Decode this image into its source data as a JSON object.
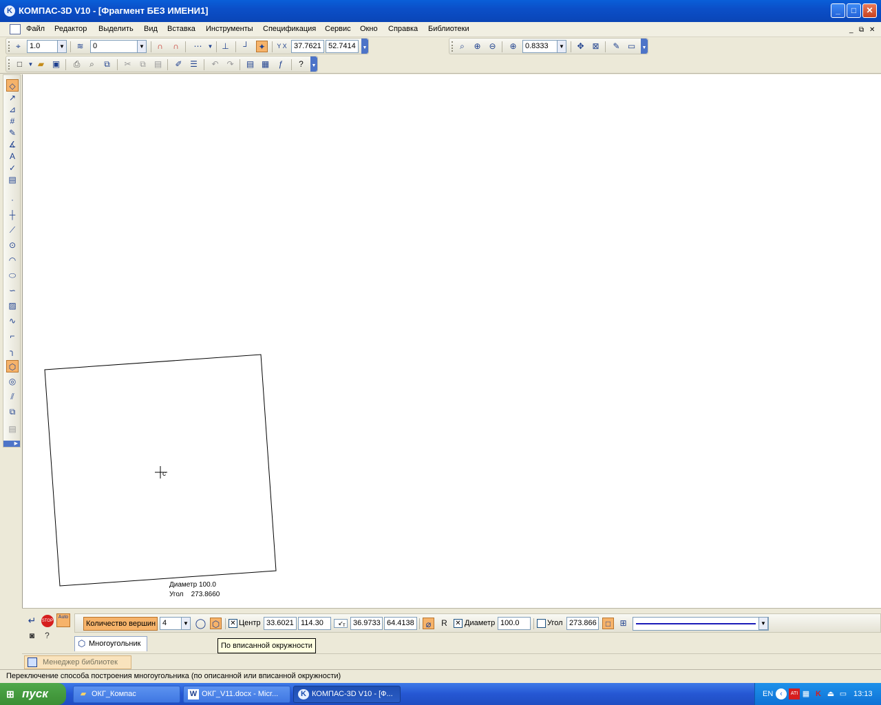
{
  "window": {
    "title": "КОМПАС-3D V10 - [Фрагмент БЕЗ ИМЕНИ1]",
    "app_icon_letter": "K",
    "minimize_glyph": "_",
    "maximize_glyph": "□",
    "close_glyph": "✕"
  },
  "menu": {
    "items": [
      "Файл",
      "Редактор",
      "Выделить",
      "Вид",
      "Вставка",
      "Инструменты",
      "Спецификация",
      "Сервис",
      "Окно",
      "Справка",
      "Библиотеки"
    ],
    "mdi_minimize": "_",
    "mdi_restore": "⧉",
    "mdi_close": "✕"
  },
  "toolbar_current_state": {
    "step": "1.0",
    "layer": "0",
    "cursor_x": "37.7621",
    "cursor_y": "52.7414",
    "cursor_xy_label": "Y X"
  },
  "toolbar_view": {
    "zoom": "0.8333"
  },
  "drawing": {
    "polygon_vertices": 4,
    "annotation_diameter": "Диаметр 100.0",
    "annotation_angle": "Угол    273.8660",
    "cursor_label": "c"
  },
  "property_panel": {
    "vertex_count_label": "Количество вершин",
    "vertex_count_value": "4",
    "center_label": "Центр",
    "center_x": "33.6021",
    "center_y": "114.30",
    "point_label": "т",
    "point_x": "36.9733",
    "point_y": "64.4138",
    "r_label": "R",
    "diameter_label": "Диаметр",
    "diameter_value": "100.0",
    "angle_label": "Угол",
    "angle_value": "273.866",
    "tab_label": "Многоугольник",
    "tooltip": "По вписанной окружности",
    "auto_label": "Auto",
    "stop_label": "STOP"
  },
  "library_manager": {
    "label": "Менеджер библиотек"
  },
  "status": {
    "text": "Переключение способа построения многоугольника (по описанной или вписанной окружности)"
  },
  "taskbar": {
    "start_label": "пуск",
    "tasks": [
      {
        "label": "ОКГ_Компас",
        "icon": "folder-icon"
      },
      {
        "label": "ОКГ_V11.docx - Micr...",
        "icon": "word-icon"
      },
      {
        "label": "КОМПАС-3D V10 - [Ф...",
        "icon": "kompas-icon"
      }
    ],
    "lang": "EN",
    "clock": "13:13"
  },
  "colors": {
    "active_highlight": "#f6b36a",
    "title_bar": "#0a5fd8",
    "canvas": "#ffffff",
    "line_style": "#1a1ab8"
  }
}
